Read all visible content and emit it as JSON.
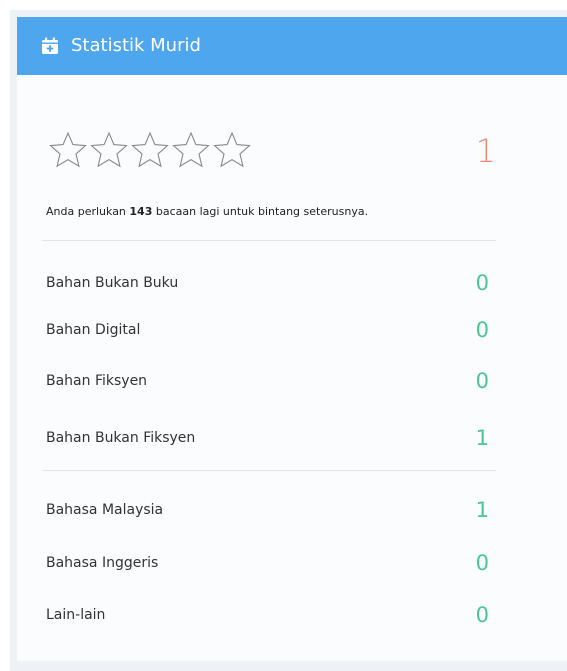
{
  "header": {
    "title": "Statistik Murid",
    "icon": "calendar-plus-icon"
  },
  "rating": {
    "stars_total": 5,
    "stars_filled": 0,
    "count": "1",
    "count_color": "#ee8b78"
  },
  "progress_note": {
    "prefix": "Anda perlukan",
    "number": "143",
    "suffix": "bacaan lagi untuk bintang seterusnya."
  },
  "categories": [
    {
      "label": "Bahan Bukan Buku",
      "value": "0"
    },
    {
      "label": "Bahan Digital",
      "value": "0"
    },
    {
      "label": "Bahan Fiksyen",
      "value": "0"
    },
    {
      "label": "Bahan Bukan Fiksyen",
      "value": "1"
    }
  ],
  "languages": [
    {
      "label": "Bahasa Malaysia",
      "value": "1"
    },
    {
      "label": "Bahasa Inggeris",
      "value": "0"
    },
    {
      "label": "Lain-lain",
      "value": "0"
    }
  ],
  "colors": {
    "header": "#4ea6ef",
    "value": "#4cc595"
  }
}
